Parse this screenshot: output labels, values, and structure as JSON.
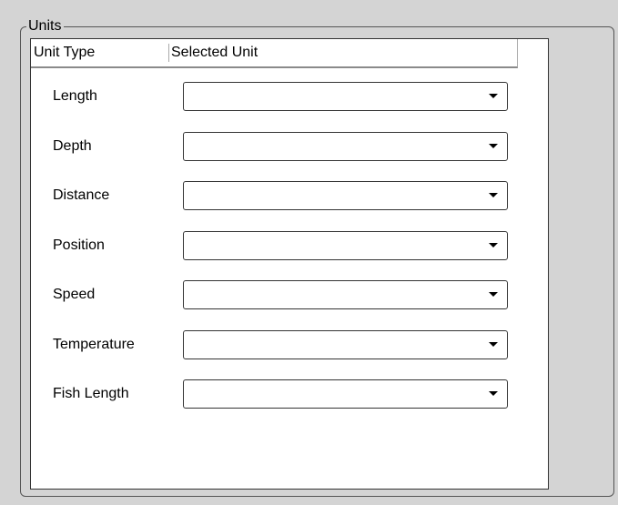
{
  "group": {
    "title": "Units"
  },
  "table": {
    "columns": [
      "Unit Type",
      "Selected Unit"
    ],
    "rows": [
      {
        "label": "Length",
        "value": ""
      },
      {
        "label": "Depth",
        "value": ""
      },
      {
        "label": "Distance",
        "value": ""
      },
      {
        "label": "Position",
        "value": ""
      },
      {
        "label": "Speed",
        "value": ""
      },
      {
        "label": "Temperature",
        "value": ""
      },
      {
        "label": "Fish Length",
        "value": ""
      }
    ]
  },
  "icons": {
    "dropdown": "chevron-down-icon"
  }
}
